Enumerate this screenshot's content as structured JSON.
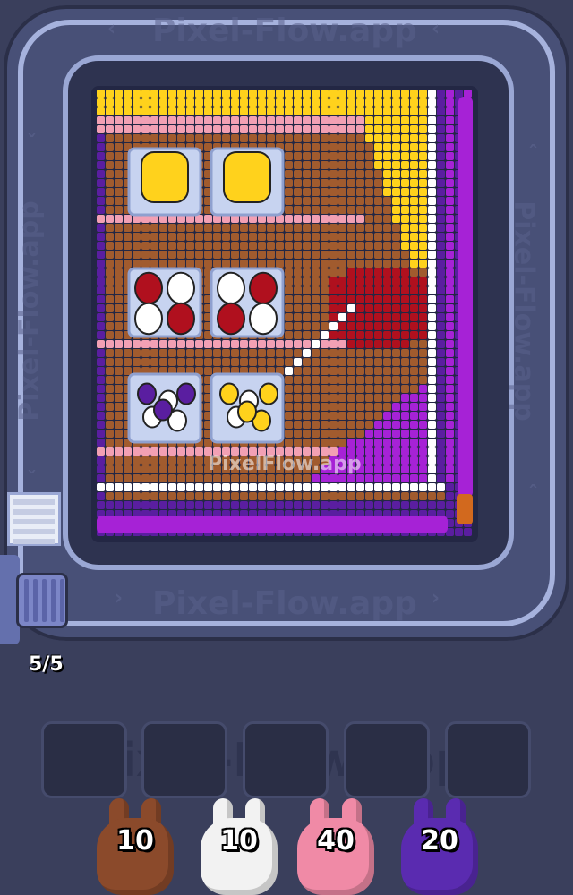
{
  "watermark": "Pixel-Flow.app",
  "board_watermark": "PixelFlow.app",
  "queue_counter": "5/5",
  "slots": [
    "",
    "",
    "",
    "",
    ""
  ],
  "shooters": [
    {
      "count": "10",
      "color": "#8b4a2b",
      "color_name": "brown"
    },
    {
      "count": "10",
      "color": "#f2f2f2",
      "color_name": "white"
    },
    {
      "count": "40",
      "color": "#f08aa6",
      "color_name": "pink"
    },
    {
      "count": "20",
      "color": "#5a2bb0",
      "color_name": "purple"
    }
  ],
  "palette": {
    "yellow": "#ffd21c",
    "pink": "#f2a0b4",
    "brown": "#a15b2e",
    "white": "#ffffff",
    "red": "#b0101e",
    "purple": "#a622d6",
    "darkpurple": "#5a1ea0",
    "glass": "#c7d3f0"
  },
  "icons": [
    "chevron-left-icon",
    "chevron-right-icon",
    "chevron-up-icon",
    "chevron-down-icon"
  ]
}
